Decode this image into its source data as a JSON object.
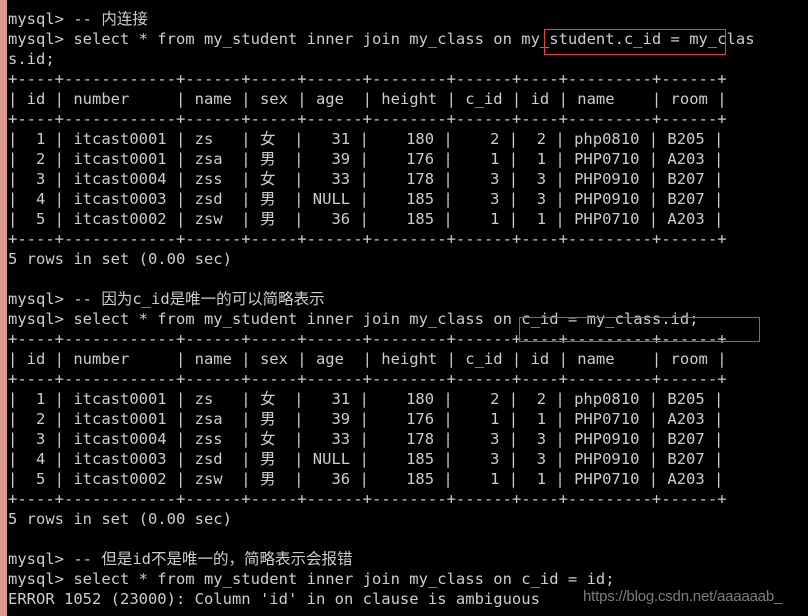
{
  "window": {
    "title": "MySQL Terminal — inner join",
    "background_color": "#000000",
    "text_color": "#cccccc",
    "gutter_color": "#d99b8d",
    "highlight_color": "#e8413c",
    "watermark_color": "#7d7d7d"
  },
  "watermark": {
    "text": "https://blog.csdn.net/aaaaaab_"
  },
  "highlights": [
    {
      "name": "my_student.c_id",
      "text": "my_student.c_id"
    },
    {
      "name": "on c_id = my_class.id;",
      "text": "on c_id = my_class.id;"
    }
  ],
  "terminal": {
    "prompt": "mysql>",
    "lines": [
      "mysql> -- 内连接",
      "mysql> select * from my_student inner join my_class on my_student.c_id = my_clas",
      "s.id;",
      "+----+------------+------+-----+------+--------+------+----+---------+------+",
      "| id | number     | name | sex | age  | height | c_id | id | name    | room |",
      "+----+------------+------+-----+------+--------+------+----+---------+------+",
      "|  1 | itcast0001 | zs   | 女  |   31 |    180 |    2 |  2 | php0810 | B205 |",
      "|  2 | itcast0001 | zsa  | 男  |   39 |    176 |    1 |  1 | PHP0710 | A203 |",
      "|  3 | itcast0004 | zss  | 女  |   33 |    178 |    3 |  3 | PHP0910 | B207 |",
      "|  4 | itcast0003 | zsd  | 男  | NULL |    185 |    3 |  3 | PHP0910 | B207 |",
      "|  5 | itcast0002 | zsw  | 男  |   36 |    185 |    1 |  1 | PHP0710 | A203 |",
      "+----+------------+------+-----+------+--------+------+----+---------+------+",
      "5 rows in set (0.00 sec)",
      "",
      "mysql> -- 因为c_id是唯一的可以简略表示",
      "mysql> select * from my_student inner join my_class on c_id = my_class.id;",
      "+----+------------+------+-----+------+--------+------+----+---------+------+",
      "| id | number     | name | sex | age  | height | c_id | id | name    | room |",
      "+----+------------+------+-----+------+--------+------+----+---------+------+",
      "|  1 | itcast0001 | zs   | 女  |   31 |    180 |    2 |  2 | php0810 | B205 |",
      "|  2 | itcast0001 | zsa  | 男  |   39 |    176 |    1 |  1 | PHP0710 | A203 |",
      "|  3 | itcast0004 | zss  | 女  |   33 |    178 |    3 |  3 | PHP0910 | B207 |",
      "|  4 | itcast0003 | zsd  | 男  | NULL |    185 |    3 |  3 | PHP0910 | B207 |",
      "|  5 | itcast0002 | zsw  | 男  |   36 |    185 |    1 |  1 | PHP0710 | A203 |",
      "+----+------------+------+-----+------+--------+------+----+---------+------+",
      "5 rows in set (0.00 sec)",
      "",
      "mysql> -- 但是id不是唯一的，简略表示会报错",
      "mysql> select * from my_student inner join my_class on c_id = id;",
      "ERROR 1052 (23000): Column 'id' in on clause is ambiguous"
    ],
    "queries": [
      {
        "comment": "-- 内连接",
        "sql": "select * from my_student inner join my_class on my_student.c_id = my_class.id;",
        "status": "5 rows in set (0.00 sec)"
      },
      {
        "comment": "-- 因为c_id是唯一的可以简略表示",
        "sql": "select * from my_student inner join my_class on c_id = my_class.id;",
        "status": "5 rows in set (0.00 sec)"
      },
      {
        "comment": "-- 但是id不是唯一的，简略表示会报错",
        "sql": "select * from my_student inner join my_class on c_id = id;",
        "status": "ERROR 1052 (23000): Column 'id' in on clause is ambiguous"
      }
    ],
    "result_table": {
      "columns": [
        "id",
        "number",
        "name",
        "sex",
        "age",
        "height",
        "c_id",
        "id",
        "name",
        "room"
      ],
      "rows": [
        [
          "1",
          "itcast0001",
          "zs",
          "女",
          "31",
          "180",
          "2",
          "2",
          "php0810",
          "B205"
        ],
        [
          "2",
          "itcast0001",
          "zsa",
          "男",
          "39",
          "176",
          "1",
          "1",
          "PHP0710",
          "A203"
        ],
        [
          "3",
          "itcast0004",
          "zss",
          "女",
          "33",
          "178",
          "3",
          "3",
          "PHP0910",
          "B207"
        ],
        [
          "4",
          "itcast0003",
          "zsd",
          "男",
          "NULL",
          "185",
          "3",
          "3",
          "PHP0910",
          "B207"
        ],
        [
          "5",
          "itcast0002",
          "zsw",
          "男",
          "36",
          "185",
          "1",
          "1",
          "PHP0710",
          "A203"
        ]
      ],
      "row_count_text": "5 rows in set (0.00 sec)"
    }
  }
}
